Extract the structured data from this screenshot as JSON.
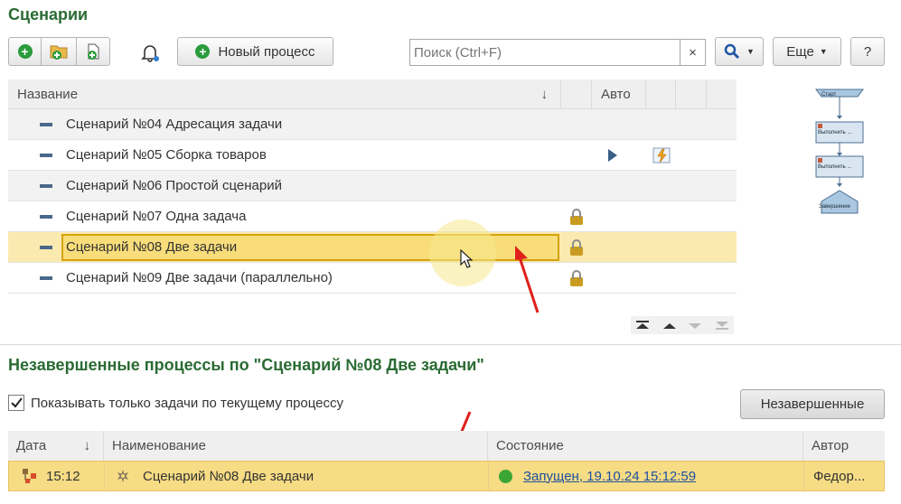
{
  "header": {
    "title": "Сценарии"
  },
  "toolbar": {
    "new_process_label": "Новый процесс",
    "search_placeholder": "Поиск (Ctrl+F)",
    "clear_label": "×",
    "more_label": "Еще",
    "help_label": "?"
  },
  "scenarios_table": {
    "columns": {
      "name": "Название",
      "sort": "↓",
      "auto": "Авто"
    },
    "rows": [
      {
        "name": "Сценарий №04 Адресация задачи"
      },
      {
        "name": "Сценарий №05 Сборка товаров"
      },
      {
        "name": "Сценарий №06 Простой сценарий"
      },
      {
        "name": "Сценарий №07 Одна задача"
      },
      {
        "name": "Сценарий №08 Две задачи"
      },
      {
        "name": "Сценарий №09 Две задачи (параллельно)"
      }
    ]
  },
  "flowchart": {
    "start": "Старт",
    "step1": "Выполнить ...",
    "step2": "Выполнить ...",
    "end": "Завершение"
  },
  "processes": {
    "title": "Незавершенные процессы по \"Сценарий №08 Две задачи\"",
    "checkbox_label": "Показывать только задачи по текущему процессу",
    "checkbox_checked": true,
    "filter_button": "Незавершенные",
    "columns": {
      "date": "Дата",
      "sort": "↓",
      "name": "Наименование",
      "state": "Состояние",
      "author": "Автор"
    },
    "rows": [
      {
        "date": "15:12",
        "name": "Сценарий №08 Две задачи",
        "state": "Запущен, 19.10.24 15:12:59",
        "author": "Федор..."
      }
    ]
  },
  "colors": {
    "accent_green": "#2a6b34",
    "selection": "#fbeab0",
    "arrow_red": "#e0201b"
  }
}
